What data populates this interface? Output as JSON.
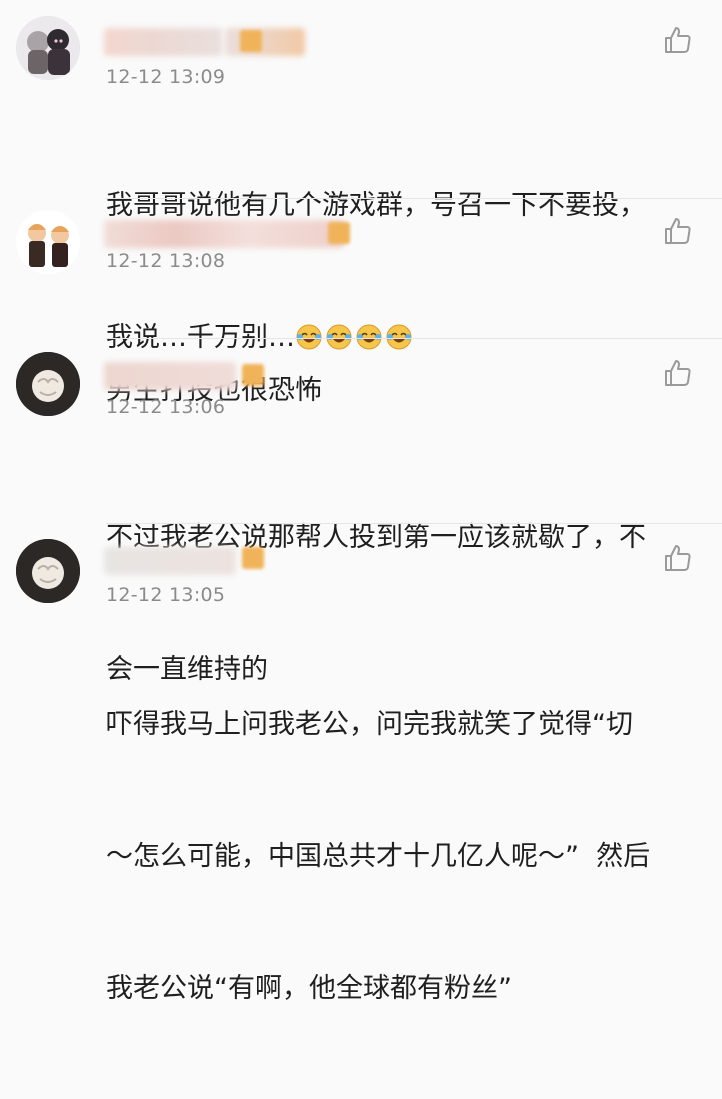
{
  "comments": [
    {
      "timestamp": "12-12 13:09",
      "lines": [
        "我哥哥说他有几个游戏群，号召一下不要投，",
        "我说…千万别…"
      ],
      "emoji_icons": [
        "laughing-crying-emoji",
        "laughing-crying-emoji",
        "laughing-crying-emoji",
        "laughing-crying-emoji"
      ]
    },
    {
      "timestamp": "12-12 13:08",
      "lines": [
        "男生打投也很恐怖"
      ]
    },
    {
      "timestamp": "12-12 13:06",
      "lines": [
        "不过我老公说那帮人投到第一应该就歇了，不",
        "会一直维持的"
      ]
    },
    {
      "timestamp": "12-12 13:05",
      "lines": [
        "吓得我马上问我老公，问完我就笑了觉得“切",
        "～怎么可能，中国总共才十几亿人呢～”  然后",
        "我老公说“有啊，他全球都有粉丝”"
      ]
    }
  ],
  "icons": {
    "like": "thumbs-up-icon"
  },
  "colors": {
    "background": "#fafafa",
    "timestamp": "#8b8b8b",
    "text": "#1f1f1f",
    "badge": "#f0b35a"
  }
}
